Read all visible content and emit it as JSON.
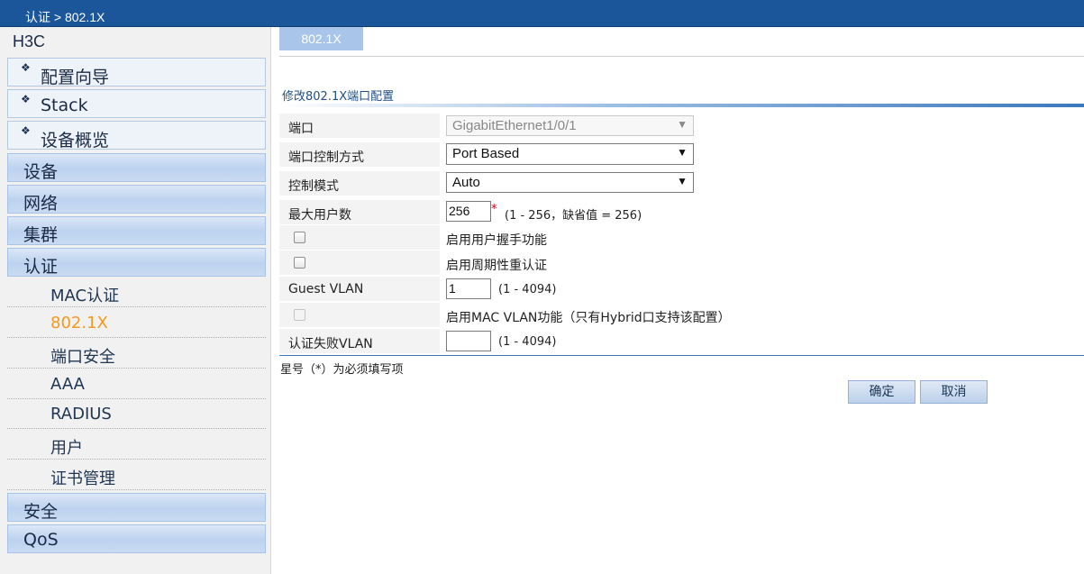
{
  "header": {
    "breadcrumb": "认证 > 802.1X"
  },
  "sidebar": {
    "brand": "H3C",
    "top_items": [
      {
        "label": "配置向导",
        "icon": "diamond-bullet-icon"
      },
      {
        "label": "Stack",
        "icon": "diamond-bullet-icon"
      },
      {
        "label": "设备概览",
        "icon": "diamond-bullet-icon"
      }
    ],
    "diamond": "❖",
    "categories": [
      "设备",
      "网络",
      "集群",
      "认证"
    ],
    "auth_sub_items": [
      {
        "label": "MAC认证",
        "active": false
      },
      {
        "label": "802.1X",
        "active": true
      },
      {
        "label": "端口安全",
        "active": false
      },
      {
        "label": "AAA",
        "active": false
      },
      {
        "label": "RADIUS",
        "active": false
      },
      {
        "label": "用户",
        "active": false
      },
      {
        "label": "证书管理",
        "active": false
      }
    ],
    "bottom_categories": [
      "安全",
      "QoS"
    ]
  },
  "main": {
    "tab": "802.1X",
    "section_title": "修改802.1X端口配置",
    "form": {
      "port": {
        "label": "端口",
        "value": "GigabitEthernet1/0/1",
        "disabled": true
      },
      "port_control": {
        "label": "端口控制方式",
        "value": "Port Based"
      },
      "control_mode": {
        "label": "控制模式",
        "value": "Auto"
      },
      "max_users": {
        "label": "最大用户数",
        "value": "256",
        "required_mark": "*",
        "hint": "(1 - 256，缺省值 = 256)"
      },
      "handshake": {
        "label": "启用用户握手功能",
        "checked": false
      },
      "periodic_reauth": {
        "label": "启用周期性重认证",
        "checked": false
      },
      "guest_vlan": {
        "label": "Guest VLAN",
        "value": "1",
        "hint": "(1 - 4094)"
      },
      "mac_vlan": {
        "label": "启用MAC VLAN功能（只有Hybrid口支持该配置）",
        "checked": false,
        "disabled": true
      },
      "auth_fail_vlan": {
        "label": "认证失败VLAN",
        "value": "",
        "hint": "(1 - 4094)"
      }
    },
    "required_note": "星号（*）为必须填写项",
    "buttons": {
      "ok": "确定",
      "cancel": "取消"
    },
    "dropdown_arrow": "▼"
  },
  "colors": {
    "header": "#1b569b",
    "active_menu": "#f39a21",
    "required": "#d0021b",
    "accent": "#3b78bd"
  }
}
